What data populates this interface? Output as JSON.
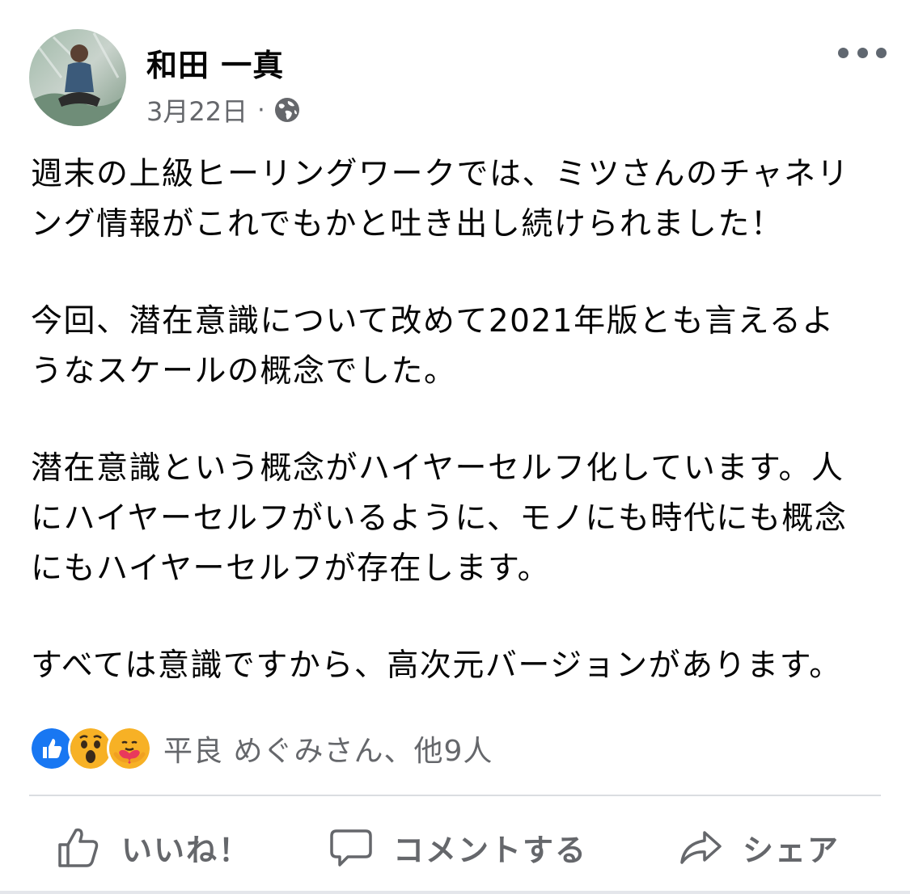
{
  "post": {
    "author": "和田 一真",
    "date": "3月22日",
    "separator": "·",
    "privacy_icon": "globe-icon",
    "more_icon": "more-horizontal-icon",
    "paragraphs": [
      "週末の上級ヒーリングワークでは、ミツさんのチャネリ\nング情報がこれでもかと吐き出し続けられました！",
      "今回、潜在意識について改めて2021年版とも言えるよ\nうなスケールの概念でした。",
      "潜在意識という概念がハイヤーセルフ化しています。人\nにハイヤーセルフがいるように、モノにも時代にも概念\nにもハイヤーセルフが存在します。",
      "すべては意識ですから、高次元バージョンがあります。"
    ]
  },
  "reactions": {
    "icons": [
      "like-reaction-icon",
      "wow-reaction-icon",
      "care-reaction-icon"
    ],
    "summary": "平良 めぐみさん、他9人"
  },
  "actions": {
    "like": "いいね！",
    "comment": "コメントする",
    "share": "シェア"
  },
  "colors": {
    "text": "#050505",
    "secondary": "#65676b",
    "like_blue": "#1877f2",
    "divider": "#dadde1"
  }
}
